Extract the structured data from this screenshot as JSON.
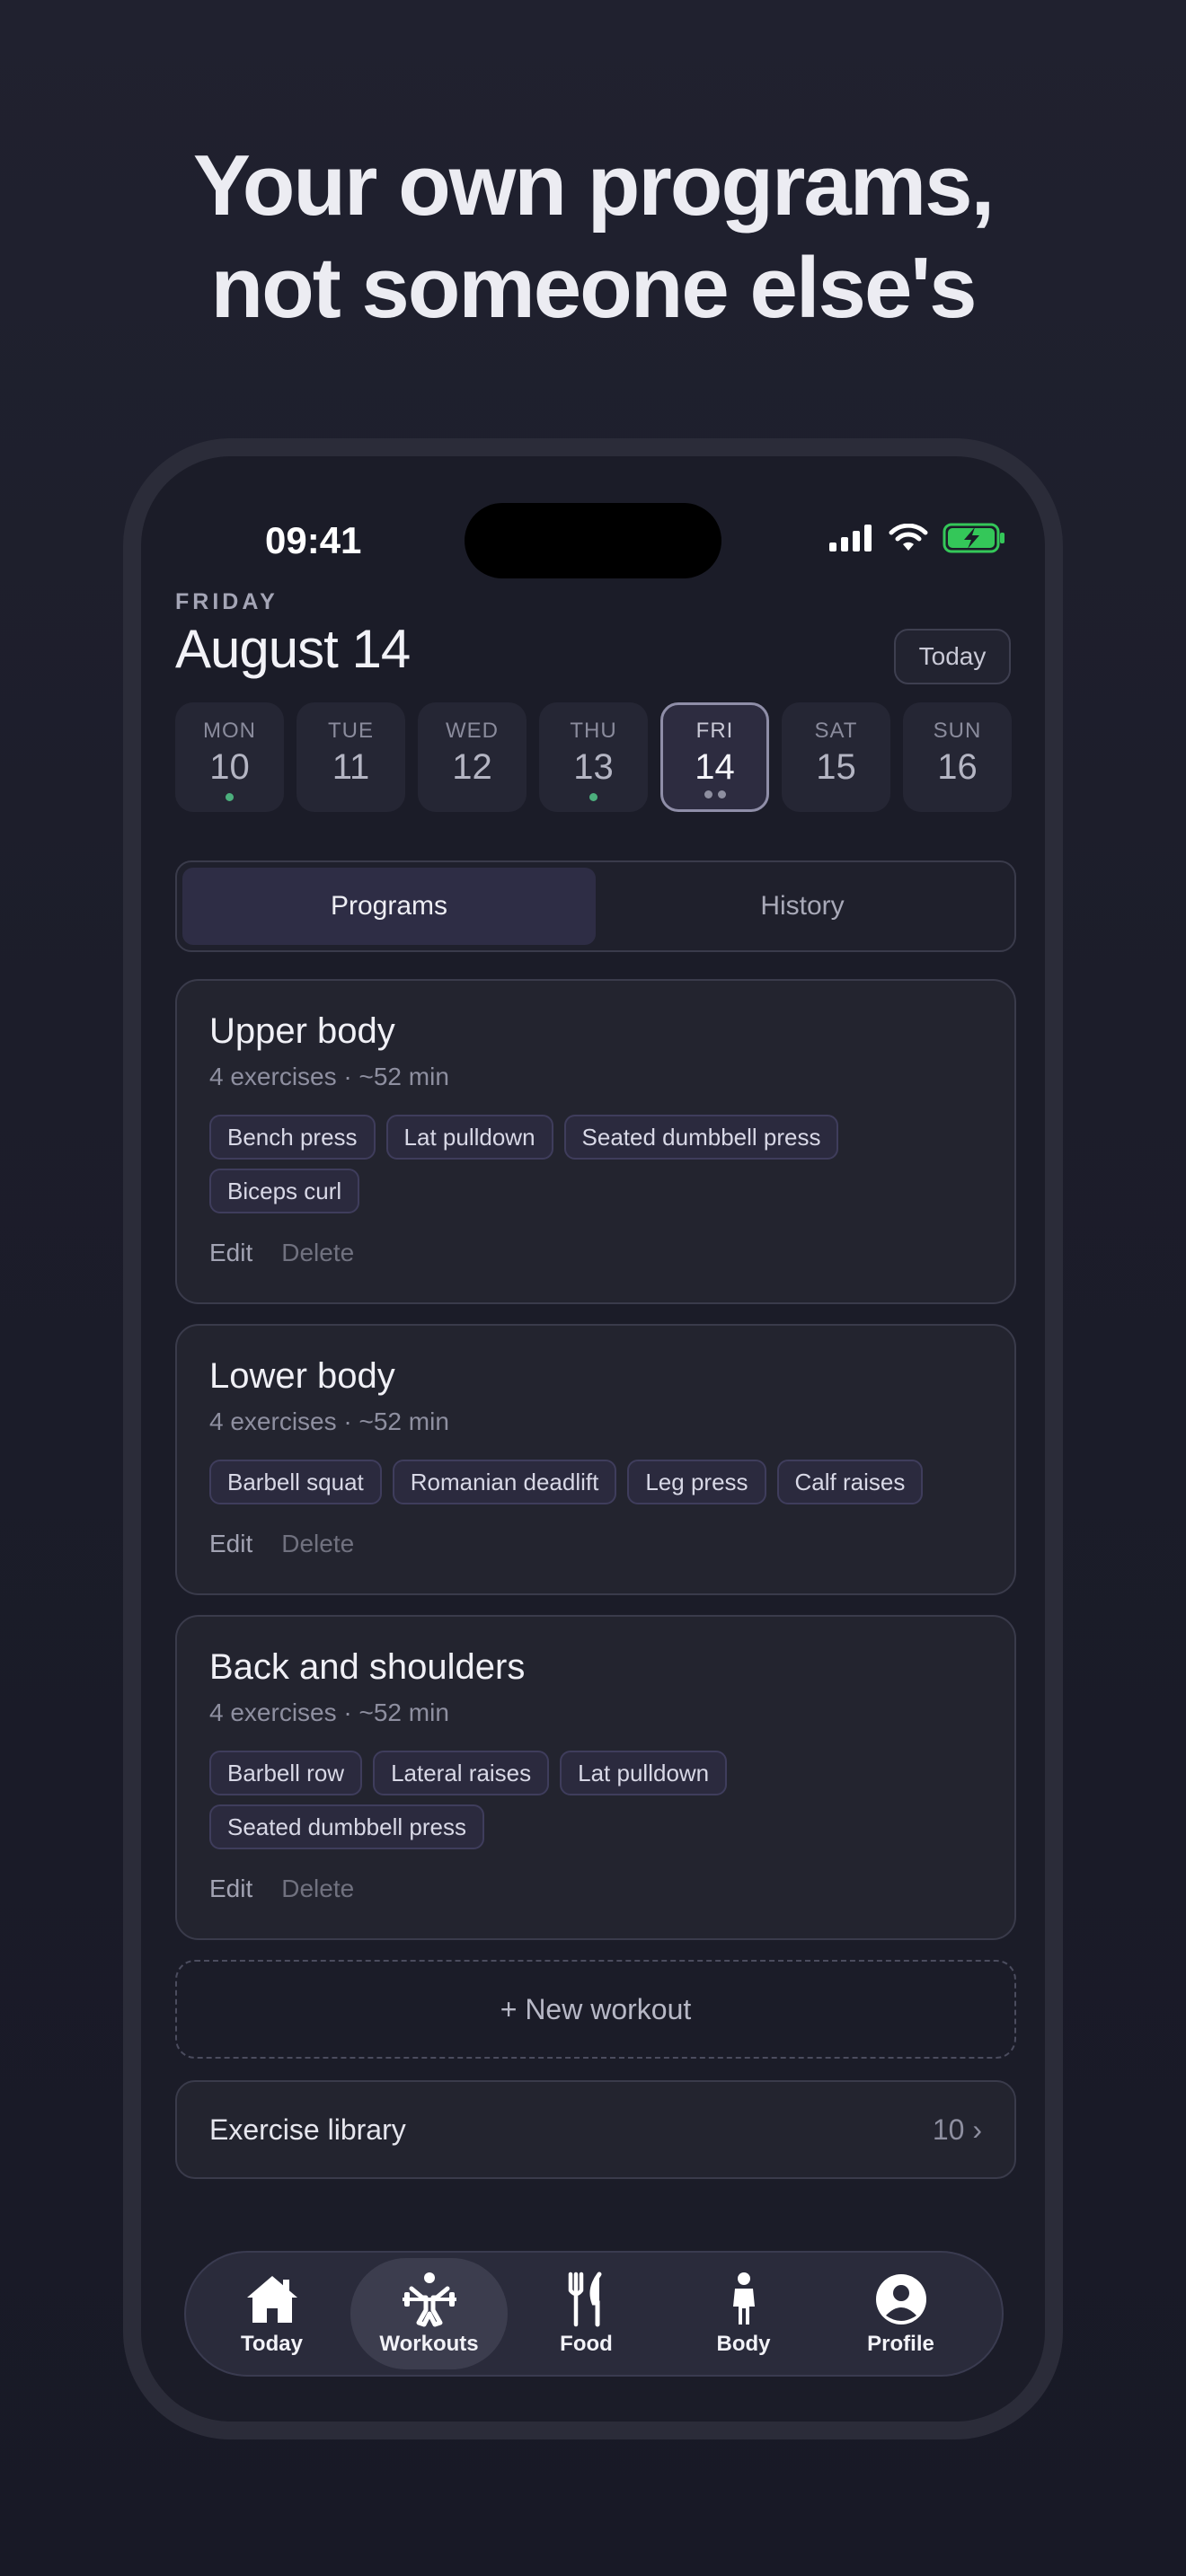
{
  "headline": {
    "line1": "Your own programs,",
    "line2": "not someone else's"
  },
  "status_bar": {
    "time": "09:41"
  },
  "header": {
    "day_name": "FRIDAY",
    "date": "August 14",
    "today_button": "Today"
  },
  "week": [
    {
      "label": "MON",
      "num": "10",
      "dots": [
        "green"
      ]
    },
    {
      "label": "TUE",
      "num": "11",
      "dots": []
    },
    {
      "label": "WED",
      "num": "12",
      "dots": []
    },
    {
      "label": "THU",
      "num": "13",
      "dots": [
        "green"
      ]
    },
    {
      "label": "FRI",
      "num": "14",
      "dots": [
        "grey",
        "grey"
      ],
      "selected": true
    },
    {
      "label": "SAT",
      "num": "15",
      "dots": []
    },
    {
      "label": "SUN",
      "num": "16",
      "dots": []
    }
  ],
  "segmented": {
    "programs": "Programs",
    "history": "History",
    "active": "programs"
  },
  "programs": [
    {
      "title": "Upper body",
      "meta": "4 exercises · ~52 min",
      "tags": [
        "Bench press",
        "Lat pulldown",
        "Seated dumbbell press",
        "Biceps curl"
      ],
      "edit": "Edit",
      "delete": "Delete"
    },
    {
      "title": "Lower body",
      "meta": "4 exercises · ~52 min",
      "tags": [
        "Barbell squat",
        "Romanian deadlift",
        "Leg press",
        "Calf raises"
      ],
      "edit": "Edit",
      "delete": "Delete"
    },
    {
      "title": "Back and shoulders",
      "meta": "4 exercises · ~52 min",
      "tags": [
        "Barbell row",
        "Lateral raises",
        "Lat pulldown",
        "Seated dumbbell press"
      ],
      "edit": "Edit",
      "delete": "Delete"
    }
  ],
  "new_workout": "+ New workout",
  "library": {
    "label": "Exercise library",
    "count": "10 ›"
  },
  "tabbar": [
    {
      "label": "Today",
      "icon": "house-icon"
    },
    {
      "label": "Workouts",
      "icon": "weightlifter-icon",
      "active": true
    },
    {
      "label": "Food",
      "icon": "fork-knife-icon"
    },
    {
      "label": "Body",
      "icon": "person-icon"
    },
    {
      "label": "Profile",
      "icon": "profile-circle-icon"
    }
  ],
  "colors": {
    "accent_dot": "#4caf7d",
    "battery": "#34c759",
    "background": "#1c1d2a"
  }
}
